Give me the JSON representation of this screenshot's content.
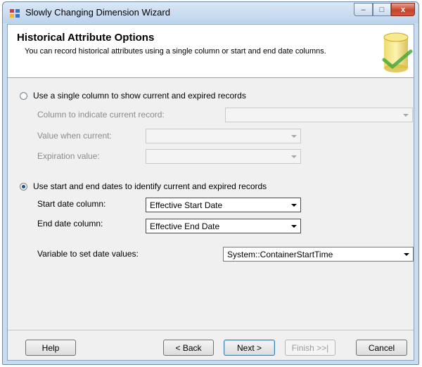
{
  "window": {
    "title": "Slowly Changing Dimension Wizard",
    "controls": {
      "minimize_glyph": "–",
      "maximize_glyph": "□",
      "close_glyph": "x"
    }
  },
  "header": {
    "title": "Historical Attribute Options",
    "description": "You can record historical attributes using a single column or start and end date columns.",
    "icon": "cylinder-check-icon"
  },
  "options": {
    "single_column": {
      "label": "Use a single column to show current and expired records",
      "selected": false,
      "current_record_label": "Column to indicate current record:",
      "current_record_value": "",
      "value_when_current_label": "Value when current:",
      "value_when_current_value": "",
      "expiration_value_label": "Expiration value:",
      "expiration_value_value": ""
    },
    "date_range": {
      "label": "Use start and end dates to identify current and expired records",
      "selected": true,
      "start_date_label": "Start date column:",
      "start_date_value": "Effective Start Date",
      "end_date_label": "End date column:",
      "end_date_value": "Effective End Date",
      "variable_label": "Variable to set date values:",
      "variable_value": "System::ContainerStartTime"
    }
  },
  "footer": {
    "help": "Help",
    "back": "< Back",
    "next": "Next >",
    "finish": "Finish >>|",
    "cancel": "Cancel"
  },
  "colors": {
    "title_bar": "#bcd3ec",
    "close_button": "#c5442a",
    "client_bg": "#f0f0f0",
    "header_bg": "#ffffff",
    "radio_dot": "#1b4e98"
  }
}
